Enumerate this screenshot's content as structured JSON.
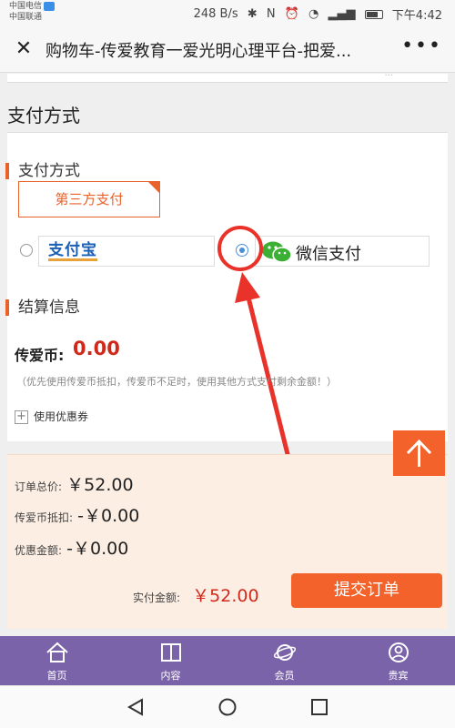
{
  "status_bar": {
    "carrier_1": "中国电信",
    "carrier_2": "中国联通",
    "speed": "248 B/s",
    "battery_level": 0.55,
    "time": "下午4:42"
  },
  "title_bar": {
    "title": "购物车-传爱教育一爱光明心理平台-把爱..."
  },
  "payment": {
    "cut_off_text": "...",
    "section_title": "支付方式",
    "sub_title": "支付方式",
    "third_party_tab": "第三方支付",
    "alipay_label": "支付宝",
    "wechat_label": "微信支付",
    "alipay_selected": false,
    "wechat_selected": true
  },
  "settlement": {
    "sub_title": "结算信息",
    "coin_label": "传爱币:",
    "coin_value": "0.00",
    "hint": "（优先使用传爱币抵扣，传爱币不足时，使用其他方式支付剩余金额！）",
    "coupon_label": "使用优惠券"
  },
  "summary": {
    "total_label": "订单总价:",
    "total_value": "￥52.00",
    "coin_deduct_label": "传爱币抵扣:",
    "coin_deduct_value": "-￥0.00",
    "discount_label": "优惠金额:",
    "discount_value": "-￥0.00",
    "actual_label": "实付金额:",
    "actual_value": "￥52.00",
    "submit_label": "提交订单"
  },
  "bottom_nav": [
    {
      "label": "首页",
      "icon": "home-icon"
    },
    {
      "label": "内容",
      "icon": "book-icon"
    },
    {
      "label": "会员",
      "icon": "member-icon"
    },
    {
      "label": "贵宾",
      "icon": "user-icon"
    }
  ],
  "colors": {
    "accent": "#f2622a",
    "price_red": "#d0291b",
    "nav_purple": "#7a63a9",
    "annotation_red": "#e8322a"
  }
}
